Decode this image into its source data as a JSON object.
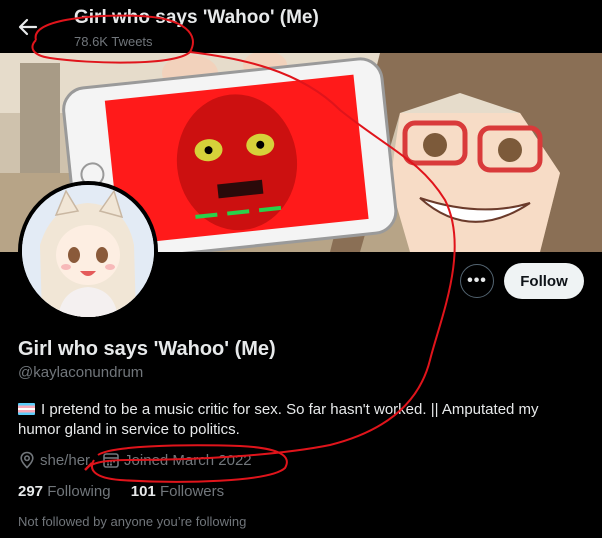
{
  "header": {
    "title": "Girl who says 'Wahoo' (Me)",
    "tweet_count": "78.6K Tweets"
  },
  "profile": {
    "display_name": "Girl who says 'Wahoo' (Me)",
    "handle": "@kaylaconundrum",
    "bio": "I pretend to be a music critic for sex. So far hasn't worked. || Amputated my humor gland in service to politics.",
    "pronouns": "she/her",
    "joined": "Joined March 2022",
    "following_count": "297",
    "following_label": "Following",
    "followers_count": "101",
    "followers_label": "Followers",
    "not_followed_note": "Not followed by anyone you’re following"
  },
  "actions": {
    "more_label": "•••",
    "follow_label": "Follow"
  },
  "icons": {
    "back": "arrow-left-icon",
    "more": "more-icon",
    "location": "location-pin-icon",
    "calendar": "calendar-icon",
    "flag": "trans-flag-icon"
  },
  "colors": {
    "background": "#000000",
    "text_primary": "#e7e9ea",
    "text_secondary": "#71767b",
    "follow_button_bg": "#eff3f4",
    "annotation_red": "#e0141b"
  }
}
